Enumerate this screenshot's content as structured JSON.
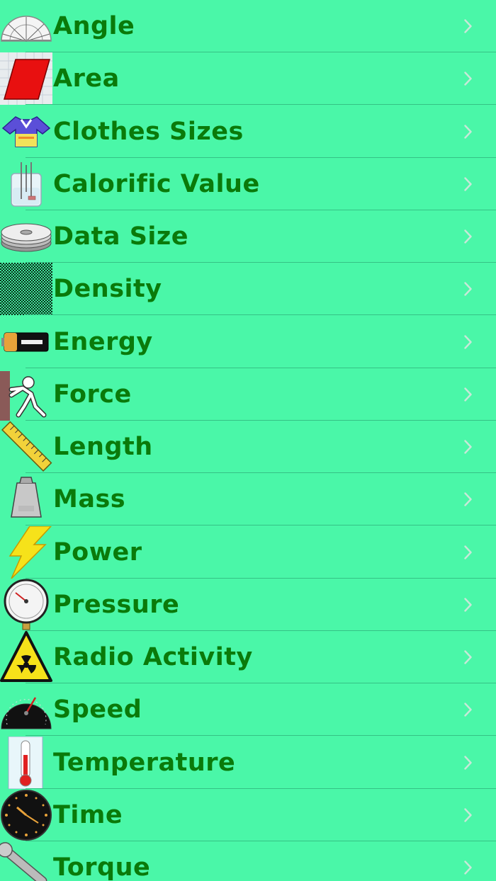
{
  "colors": {
    "background": "#4AF7A8",
    "separator": "#35C285",
    "label": "#0A7A0A",
    "chevron": "#C8E8D8"
  },
  "items": [
    {
      "label": "Angle",
      "icon": "protractor-icon",
      "name": "angle"
    },
    {
      "label": "Area",
      "icon": "parallelogram-icon",
      "name": "area"
    },
    {
      "label": "Clothes Sizes",
      "icon": "shirt-icon",
      "name": "clothes-sizes"
    },
    {
      "label": "Calorific Value",
      "icon": "beaker-icon",
      "name": "calorific-value"
    },
    {
      "label": "Data Size",
      "icon": "hard-disk-icon",
      "name": "data-size"
    },
    {
      "label": "Density",
      "icon": "checkerboard-icon",
      "name": "density"
    },
    {
      "label": "Energy",
      "icon": "battery-icon",
      "name": "energy"
    },
    {
      "label": "Force",
      "icon": "pushing-figure-icon",
      "name": "force"
    },
    {
      "label": "Length",
      "icon": "ruler-icon",
      "name": "length"
    },
    {
      "label": "Mass",
      "icon": "weight-icon",
      "name": "mass"
    },
    {
      "label": "Power",
      "icon": "lightning-icon",
      "name": "power"
    },
    {
      "label": "Pressure",
      "icon": "pressure-gauge-icon",
      "name": "pressure"
    },
    {
      "label": "Radio Activity",
      "icon": "radiation-icon",
      "name": "radio-activity"
    },
    {
      "label": "Speed",
      "icon": "speedometer-icon",
      "name": "speed"
    },
    {
      "label": "Temperature",
      "icon": "thermometer-icon",
      "name": "temperature"
    },
    {
      "label": "Time",
      "icon": "clock-icon",
      "name": "time"
    },
    {
      "label": "Torque",
      "icon": "wrench-icon",
      "name": "torque"
    }
  ]
}
